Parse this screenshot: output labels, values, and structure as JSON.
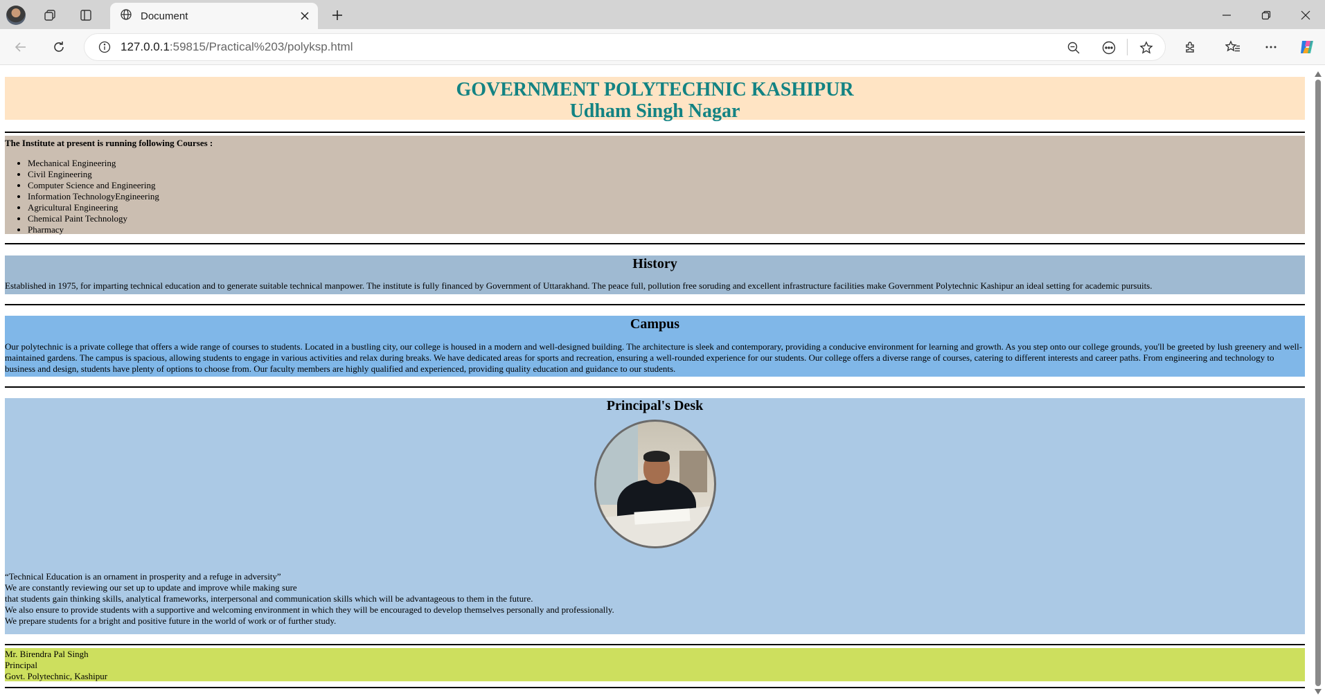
{
  "browser": {
    "tab_title": "Document",
    "url_host": "127.0.0.1",
    "url_rest": ":59815/Practical%203/polyksp.html",
    "icons": [
      "profile-avatar",
      "workspaces-icon",
      "tab-actions-icon",
      "globe-icon",
      "close-icon",
      "plus-icon",
      "minimize-icon",
      "restore-icon",
      "window-close-icon",
      "back-icon",
      "reload-icon",
      "info-icon",
      "zoom-out-icon",
      "read-aloud-icon",
      "favorite-star-icon",
      "extensions-icon",
      "favorites-icon",
      "more-icon",
      "copilot-icon"
    ]
  },
  "page": {
    "header": {
      "title": "GOVERNMENT POLYTECHNIC KASHIPUR",
      "subtitle": "Udham Singh Nagar",
      "color": "#138383",
      "background": "#ffe4c4"
    },
    "courses": {
      "heading": "The Institute at present is running following Courses :",
      "items": [
        "Mechanical Engineering",
        "Civil Engineering",
        "Computer Science and Engineering",
        "Information TechnologyEngineering",
        "Agricultural Engineering",
        "Chemical Paint Technology",
        "Pharmacy"
      ]
    },
    "history": {
      "title": "History",
      "text": "Established in 1975, for imparting technical education and to generate suitable technical manpower. The institute is fully financed by Government of Uttarakhand. The peace full, pollution free soruding and excellent infrastructure facilities make Government Polytechnic Kashipur an ideal setting for academic pursuits."
    },
    "campus": {
      "title": "Campus",
      "text": "Our polytechnic is a private college that offers a wide range of courses to students. Located in a bustling city, our college is housed in a modern and well-designed building. The architecture is sleek and contemporary, providing a conducive environment for learning and growth. As you step onto our college grounds, you'll be greeted by lush greenery and well-maintained gardens. The campus is spacious, allowing students to engage in various activities and relax during breaks. We have dedicated areas for sports and recreation, ensuring a well-rounded experience for our students. Our college offers a diverse range of courses, catering to different interests and career paths. From engineering and technology to business and design, students have plenty of options to choose from. Our faculty members are highly qualified and experienced, providing quality education and guidance to our students."
    },
    "principal": {
      "title": "Principal's Desk",
      "lines": [
        "“Technical Education is an ornament in prosperity and a refuge in adversity”",
        "We are constantly reviewing our set up to update and improve while making sure",
        "that students gain thinking skills, analytical frameworks, interpersonal and communication skills which will be advantageous to them in the future.",
        "We also ensure to provide students with a supportive and welcoming environment in which they will be encouraged to develop themselves personally and professionally.",
        "We prepare students for a bright and positive future in the world of work or of further study."
      ]
    },
    "signoff": {
      "name": "Mr. Birendra Pal Singh",
      "role": "Principal",
      "institute": "Govt. Polytechnic, Kashipur"
    }
  }
}
